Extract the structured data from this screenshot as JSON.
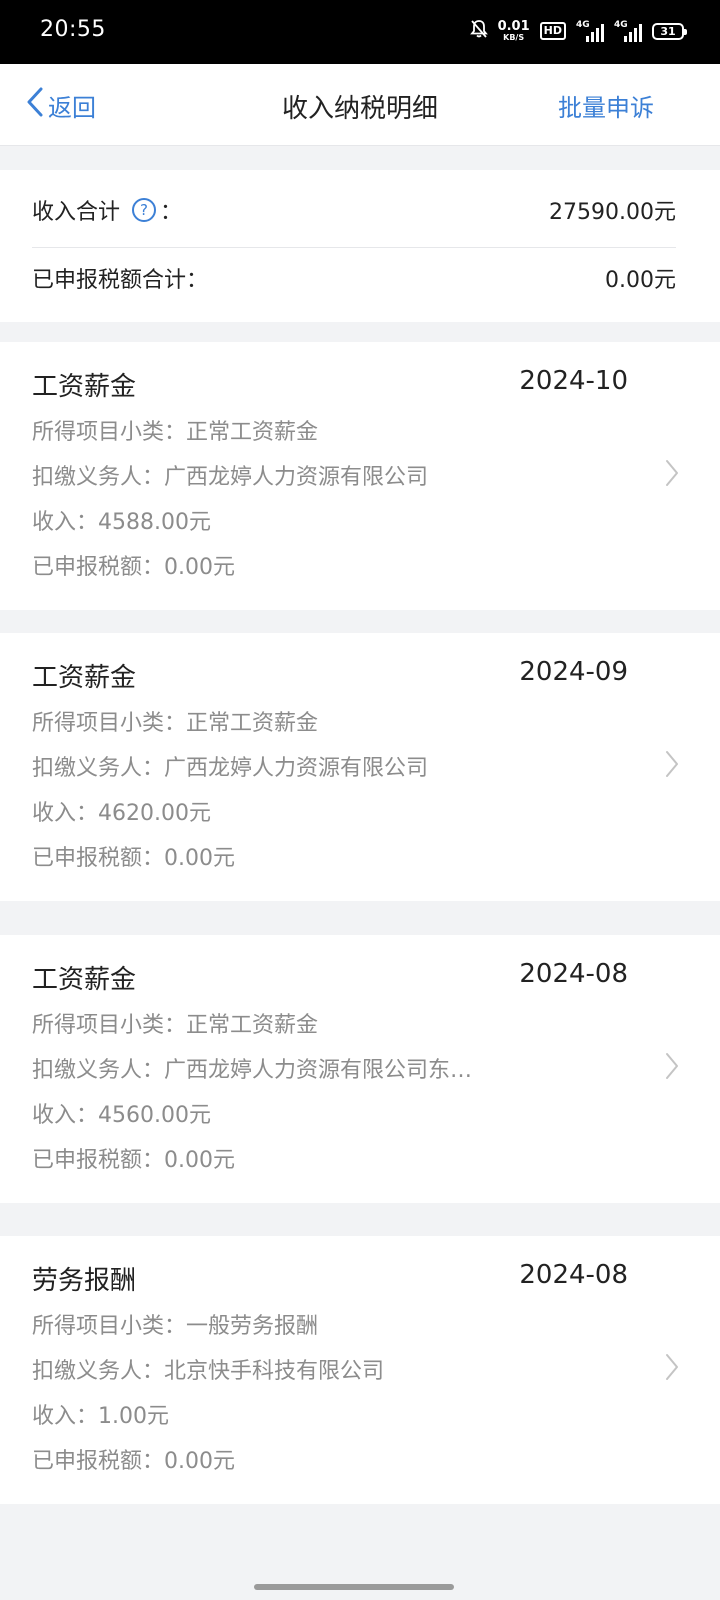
{
  "status_bar": {
    "time": "20:55",
    "net_speed_value": "0.01",
    "net_speed_unit": "KB/S",
    "hd_label": "HD",
    "sim1_tag": "4G",
    "sim2_tag": "4G",
    "battery_level": "31"
  },
  "nav": {
    "back_label": "返回",
    "title": "收入纳税明细",
    "action_label": "批量申诉"
  },
  "summary": {
    "income_total_label": "收入合计",
    "income_total_colon": "：",
    "income_total_value": "27590.00元",
    "tax_total_label": "已申报税额合计：",
    "tax_total_value": "0.00元"
  },
  "records": [
    {
      "type": "工资薪金",
      "period": "2024-10",
      "subcategory_label": "所得项目小类：",
      "subcategory": "正常工资薪金",
      "withholder_label": "扣缴义务人：",
      "withholder": "广西龙婷人力资源有限公司",
      "income_label": "收入：",
      "income": "4588.00元",
      "tax_label": "已申报税额：",
      "tax": "0.00元"
    },
    {
      "type": "工资薪金",
      "period": "2024-09",
      "subcategory_label": "所得项目小类：",
      "subcategory": "正常工资薪金",
      "withholder_label": "扣缴义务人：",
      "withholder": "广西龙婷人力资源有限公司",
      "income_label": "收入：",
      "income": "4620.00元",
      "tax_label": "已申报税额：",
      "tax": "0.00元"
    },
    {
      "type": "工资薪金",
      "period": "2024-08",
      "subcategory_label": "所得项目小类：",
      "subcategory": "正常工资薪金",
      "withholder_label": "扣缴义务人：",
      "withholder": "广西龙婷人力资源有限公司东…",
      "income_label": "收入：",
      "income": "4560.00元",
      "tax_label": "已申报税额：",
      "tax": "0.00元"
    },
    {
      "type": "劳务报酬",
      "period": "2024-08",
      "subcategory_label": "所得项目小类：",
      "subcategory": "一般劳务报酬",
      "withholder_label": "扣缴义务人：",
      "withholder": "北京快手科技有限公司",
      "income_label": "收入：",
      "income": "1.00元",
      "tax_label": "已申报税额：",
      "tax": "0.00元"
    }
  ],
  "colors": {
    "accent": "#3c80d6",
    "primary_text": "#222222",
    "secondary_text": "#8c8c8c",
    "background": "#f2f3f5"
  },
  "icons": {
    "back": "chevron-left-icon",
    "help": "question-circle-icon",
    "row_arrow": "chevron-right-icon"
  }
}
